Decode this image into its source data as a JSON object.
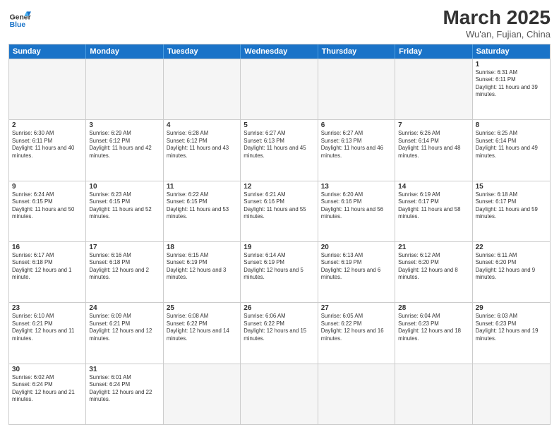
{
  "header": {
    "logo_general": "General",
    "logo_blue": "Blue",
    "month_title": "March 2025",
    "subtitle": "Wu'an, Fujian, China"
  },
  "days": [
    "Sunday",
    "Monday",
    "Tuesday",
    "Wednesday",
    "Thursday",
    "Friday",
    "Saturday"
  ],
  "weeks": [
    [
      {
        "day": "",
        "empty": true
      },
      {
        "day": "",
        "empty": true
      },
      {
        "day": "",
        "empty": true
      },
      {
        "day": "",
        "empty": true
      },
      {
        "day": "",
        "empty": true
      },
      {
        "day": "",
        "empty": true
      },
      {
        "day": "1",
        "sunrise": "6:31 AM",
        "sunset": "6:11 PM",
        "daylight": "11 hours and 39 minutes."
      }
    ],
    [
      {
        "day": "2",
        "sunrise": "6:30 AM",
        "sunset": "6:11 PM",
        "daylight": "11 hours and 40 minutes."
      },
      {
        "day": "3",
        "sunrise": "6:29 AM",
        "sunset": "6:12 PM",
        "daylight": "11 hours and 42 minutes."
      },
      {
        "day": "4",
        "sunrise": "6:28 AM",
        "sunset": "6:12 PM",
        "daylight": "11 hours and 43 minutes."
      },
      {
        "day": "5",
        "sunrise": "6:27 AM",
        "sunset": "6:13 PM",
        "daylight": "11 hours and 45 minutes."
      },
      {
        "day": "6",
        "sunrise": "6:27 AM",
        "sunset": "6:13 PM",
        "daylight": "11 hours and 46 minutes."
      },
      {
        "day": "7",
        "sunrise": "6:26 AM",
        "sunset": "6:14 PM",
        "daylight": "11 hours and 48 minutes."
      },
      {
        "day": "8",
        "sunrise": "6:25 AM",
        "sunset": "6:14 PM",
        "daylight": "11 hours and 49 minutes."
      }
    ],
    [
      {
        "day": "9",
        "sunrise": "6:24 AM",
        "sunset": "6:15 PM",
        "daylight": "11 hours and 50 minutes."
      },
      {
        "day": "10",
        "sunrise": "6:23 AM",
        "sunset": "6:15 PM",
        "daylight": "11 hours and 52 minutes."
      },
      {
        "day": "11",
        "sunrise": "6:22 AM",
        "sunset": "6:15 PM",
        "daylight": "11 hours and 53 minutes."
      },
      {
        "day": "12",
        "sunrise": "6:21 AM",
        "sunset": "6:16 PM",
        "daylight": "11 hours and 55 minutes."
      },
      {
        "day": "13",
        "sunrise": "6:20 AM",
        "sunset": "6:16 PM",
        "daylight": "11 hours and 56 minutes."
      },
      {
        "day": "14",
        "sunrise": "6:19 AM",
        "sunset": "6:17 PM",
        "daylight": "11 hours and 58 minutes."
      },
      {
        "day": "15",
        "sunrise": "6:18 AM",
        "sunset": "6:17 PM",
        "daylight": "11 hours and 59 minutes."
      }
    ],
    [
      {
        "day": "16",
        "sunrise": "6:17 AM",
        "sunset": "6:18 PM",
        "daylight": "12 hours and 1 minute."
      },
      {
        "day": "17",
        "sunrise": "6:16 AM",
        "sunset": "6:18 PM",
        "daylight": "12 hours and 2 minutes."
      },
      {
        "day": "18",
        "sunrise": "6:15 AM",
        "sunset": "6:19 PM",
        "daylight": "12 hours and 3 minutes."
      },
      {
        "day": "19",
        "sunrise": "6:14 AM",
        "sunset": "6:19 PM",
        "daylight": "12 hours and 5 minutes."
      },
      {
        "day": "20",
        "sunrise": "6:13 AM",
        "sunset": "6:19 PM",
        "daylight": "12 hours and 6 minutes."
      },
      {
        "day": "21",
        "sunrise": "6:12 AM",
        "sunset": "6:20 PM",
        "daylight": "12 hours and 8 minutes."
      },
      {
        "day": "22",
        "sunrise": "6:11 AM",
        "sunset": "6:20 PM",
        "daylight": "12 hours and 9 minutes."
      }
    ],
    [
      {
        "day": "23",
        "sunrise": "6:10 AM",
        "sunset": "6:21 PM",
        "daylight": "12 hours and 11 minutes."
      },
      {
        "day": "24",
        "sunrise": "6:09 AM",
        "sunset": "6:21 PM",
        "daylight": "12 hours and 12 minutes."
      },
      {
        "day": "25",
        "sunrise": "6:08 AM",
        "sunset": "6:22 PM",
        "daylight": "12 hours and 14 minutes."
      },
      {
        "day": "26",
        "sunrise": "6:06 AM",
        "sunset": "6:22 PM",
        "daylight": "12 hours and 15 minutes."
      },
      {
        "day": "27",
        "sunrise": "6:05 AM",
        "sunset": "6:22 PM",
        "daylight": "12 hours and 16 minutes."
      },
      {
        "day": "28",
        "sunrise": "6:04 AM",
        "sunset": "6:23 PM",
        "daylight": "12 hours and 18 minutes."
      },
      {
        "day": "29",
        "sunrise": "6:03 AM",
        "sunset": "6:23 PM",
        "daylight": "12 hours and 19 minutes."
      }
    ],
    [
      {
        "day": "30",
        "sunrise": "6:02 AM",
        "sunset": "6:24 PM",
        "daylight": "12 hours and 21 minutes."
      },
      {
        "day": "31",
        "sunrise": "6:01 AM",
        "sunset": "6:24 PM",
        "daylight": "12 hours and 22 minutes."
      },
      {
        "day": "",
        "empty": true
      },
      {
        "day": "",
        "empty": true
      },
      {
        "day": "",
        "empty": true
      },
      {
        "day": "",
        "empty": true
      },
      {
        "day": "",
        "empty": true
      }
    ]
  ]
}
